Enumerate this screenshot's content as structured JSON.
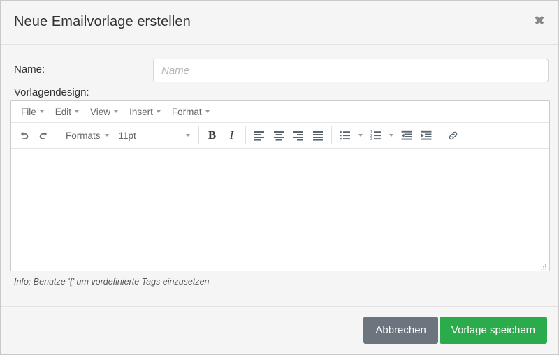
{
  "modal": {
    "title": "Neue Emailvorlage erstellen",
    "close_icon": "close-icon",
    "close_glyph": "✖"
  },
  "form": {
    "name_label": "Name:",
    "name_value": "",
    "name_placeholder": "Name",
    "design_label": "Vorlagendesign:",
    "info_text": "Info: Benutze '{' um vordefinierte Tags einzusetzen"
  },
  "editor": {
    "menubar": [
      {
        "label": "File",
        "icon": "chevron-down-icon"
      },
      {
        "label": "Edit",
        "icon": "chevron-down-icon"
      },
      {
        "label": "View",
        "icon": "chevron-down-icon"
      },
      {
        "label": "Insert",
        "icon": "chevron-down-icon"
      },
      {
        "label": "Format",
        "icon": "chevron-down-icon"
      }
    ],
    "toolbar": {
      "undo_icon": "undo-icon",
      "redo_icon": "redo-icon",
      "formats_label": "Formats",
      "fontsize_value": "11pt",
      "bold_label": "B",
      "italic_label": "I",
      "align_left_icon": "align-left-icon",
      "align_center_icon": "align-center-icon",
      "align_right_icon": "align-right-icon",
      "align_justify_icon": "align-justify-icon",
      "bullet_list_icon": "bullet-list-icon",
      "numbered_list_icon": "numbered-list-icon",
      "outdent_icon": "outdent-icon",
      "indent_icon": "indent-icon",
      "link_icon": "link-icon"
    },
    "content": "",
    "resize_icon": "resize-grip-icon"
  },
  "footer": {
    "cancel_label": "Abbrechen",
    "save_label": "Vorlage speichern"
  },
  "colors": {
    "modal_bg": "#f5f5f5",
    "border": "#c9c9c9",
    "text": "#333333",
    "muted": "#666666",
    "cancel_bg": "#6c757d",
    "save_bg": "#2bab4b",
    "editor_bg": "#ffffff"
  }
}
